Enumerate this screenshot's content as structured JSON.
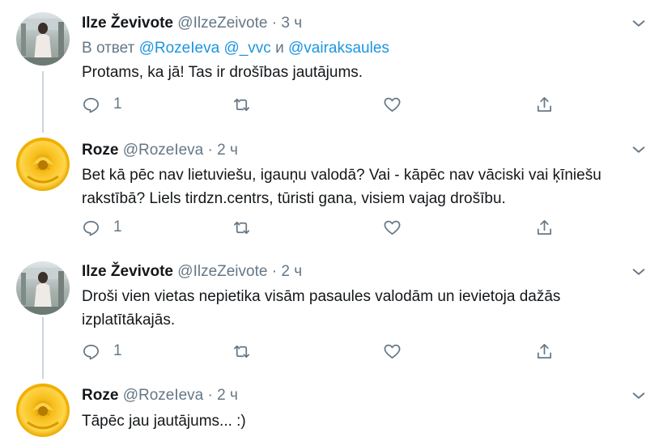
{
  "tweets": [
    {
      "name": "Ilze Ževivote",
      "handle": "@IlzeZeivote",
      "dot": "·",
      "time": "3 ч",
      "reply_prefix": "В ответ",
      "reply_to": [
        "@RozeIeva",
        "@_vvc"
      ],
      "reply_and": "и",
      "reply_last": "@vairaksaules",
      "text": "Protams, ka jā! Tas ir drošības jautājums.",
      "reply_count": "1",
      "avatar": "portrait-avatar"
    },
    {
      "name": "Roze",
      "handle": "@RozeIeva",
      "dot": "·",
      "time": "2 ч",
      "text_lines": [
        "Bet kā pēc nav lietuviešu, igauņu valodā? Vai - kāpēc nav vāciski vai ķīniešu",
        "rakstībā? Liels tirdzn.centrs, tūristi gana, visiem vajag drošību."
      ],
      "reply_count": "1",
      "avatar": "yellow-rose-avatar"
    },
    {
      "name": "Ilze Ževivote",
      "handle": "@IlzeZeivote",
      "dot": "·",
      "time": "2 ч",
      "text_lines": [
        "Droši vien vietas nepietika visām pasaules valodām un ievietoja dažās",
        "izplatītākajās."
      ],
      "reply_count": "1",
      "avatar": "portrait-avatar"
    },
    {
      "name": "Roze",
      "handle": "@RozeIeva",
      "dot": "·",
      "time": "2 ч",
      "text": "Tāpēc jau jautājums... :)",
      "avatar": "yellow-rose-avatar"
    }
  ],
  "icons": {
    "reply": "reply-icon",
    "retweet": "retweet-icon",
    "like": "heart-icon",
    "share": "share-icon",
    "more": "chevron-down-icon"
  },
  "colors": {
    "link": "#1b95e0",
    "muted": "#657786",
    "thread_line": "#ccd6dd",
    "rose": "#f5b400"
  }
}
